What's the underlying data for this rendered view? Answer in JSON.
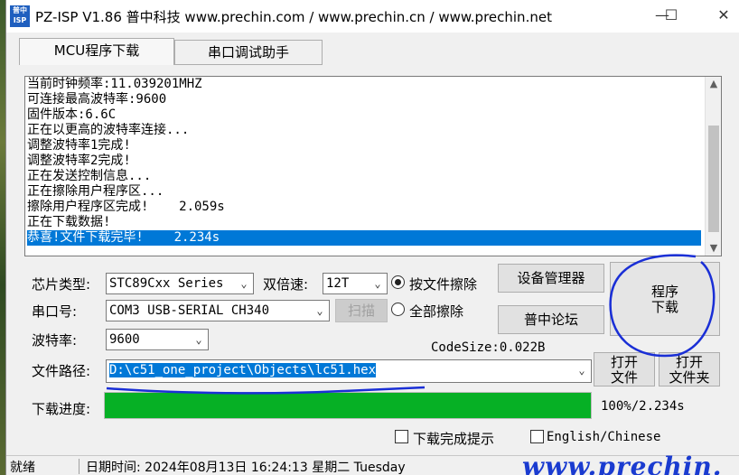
{
  "window": {
    "icon_text": "普中ISP",
    "title": "PZ-ISP V1.86 普中科技  www.prechin.com / www.prechin.cn / www.prechin.net",
    "minimize_glyph": "—",
    "maximize_glyph": "☐",
    "close_glyph": "✕"
  },
  "tabs": [
    {
      "label": "MCU程序下载",
      "active": true
    },
    {
      "label": "串口调试助手",
      "active": false
    }
  ],
  "log": {
    "lines": [
      "当前时钟频率:11.039201MHZ",
      "可连接最高波特率:9600",
      "固件版本:6.6C",
      "正在以更高的波特率连接...",
      "调整波特率1完成!",
      "调整波特率2完成!",
      "正在发送控制信息...",
      "正在擦除用户程序区...",
      "擦除用户程序区完成!    2.059s",
      "正在下载数据!",
      "恭喜!文件下载完毕!    2.234s"
    ],
    "selected_index": 10
  },
  "chip": {
    "label": "芯片类型:",
    "value": "STC89Cxx Series"
  },
  "double_speed": {
    "label": "双倍速:",
    "value": "12T"
  },
  "erase": {
    "by_file": "按文件擦除",
    "all": "全部擦除",
    "selected": "by_file"
  },
  "device_manager_button": "设备管理器",
  "forum_button": "普中论坛",
  "program_button": {
    "line1": "程序",
    "line2": "下载"
  },
  "port": {
    "label": "串口号:",
    "value": "COM3  USB-SERIAL CH340",
    "scan_button": "扫描"
  },
  "baud": {
    "label": "波特率:",
    "value": "9600"
  },
  "code_size": "CodeSize:0.022B",
  "file_path": {
    "label": "文件路径:",
    "value": "D:\\c51_one_project\\Objects\\lc51.hex"
  },
  "open_file_button": {
    "line1": "打开",
    "line2": "文件"
  },
  "open_folder_button": {
    "line1": "打开",
    "line2": "文件夹"
  },
  "progress": {
    "label": "下载进度:",
    "fraction": 1.0,
    "text": "100%/2.234s"
  },
  "options": {
    "download_prompt": "下载完成提示",
    "language": "English/Chinese"
  },
  "status": {
    "ready": "就绪",
    "datetime": "日期时间:  2024年08月13日  16:24:13  星期二  Tuesday"
  },
  "watermark": "www.prechin.",
  "colors": {
    "selection": "#0078d7",
    "progress": "#06b025",
    "annotation_ink": "#1a2fd6",
    "watermark": "#1a3bd0"
  },
  "icons": [
    "app-logo-icon",
    "minimize-icon",
    "maximize-icon",
    "close-icon",
    "chevron-down-icon",
    "scroll-up-icon",
    "scroll-down-icon"
  ]
}
